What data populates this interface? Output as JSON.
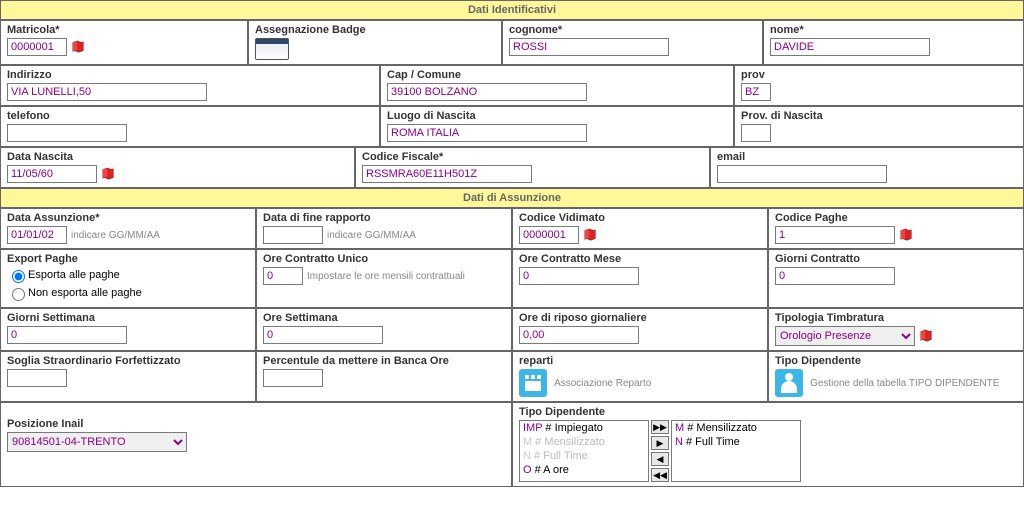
{
  "sections": {
    "identificativi": "Dati Identificativi",
    "assunzione": "Dati di Assunzione"
  },
  "ident": {
    "matricola_label": "Matricola*",
    "matricola": "0000001",
    "badge_label": "Assegnazione Badge",
    "cognome_label": "cognome*",
    "cognome": "ROSSI",
    "nome_label": "nome*",
    "nome": "DAVIDE",
    "indirizzo_label": "Indirizzo",
    "indirizzo": "VIA LUNELLI,50",
    "cap_label": "Cap / Comune",
    "cap": "39100 BOLZANO",
    "prov_label": "prov",
    "prov": "BZ",
    "telefono_label": "telefono",
    "telefono": "",
    "luogo_nascita_label": "Luogo di Nascita",
    "luogo_nascita": "ROMA ITALIA",
    "prov_nascita_label": "Prov. di Nascita",
    "prov_nascita": "",
    "data_nascita_label": "Data Nascita",
    "data_nascita": "11/05/60",
    "cf_label": "Codice Fiscale*",
    "cf": "RSSMRA60E11H501Z",
    "email_label": "email",
    "email": ""
  },
  "ass": {
    "data_ass_label": "Data Assunzione*",
    "data_ass": "01/01/02",
    "data_ass_hint": "indicare GG/MM/AA",
    "data_fine_label": "Data di fine rapporto",
    "data_fine": "",
    "data_fine_hint": "indicare GG/MM/AA",
    "cod_vid_label": "Codice Vidimato",
    "cod_vid": "0000001",
    "cod_paghe_label": "Codice Paghe",
    "cod_paghe": "1",
    "export_label": "Export Paghe",
    "export_opt1": "Esporta alle paghe",
    "export_opt2": "Non esporta alle paghe",
    "ore_unico_label": "Ore Contratto Unico",
    "ore_unico": "0",
    "ore_unico_hint": "Impostare le ore mensili contrattuali",
    "ore_mese_label": "Ore Contratto Mese",
    "ore_mese": "0",
    "giorni_contr_label": "Giorni Contratto",
    "giorni_contr": "0",
    "giorni_sett_label": "Giorni Settimana",
    "giorni_sett": "0",
    "ore_sett_label": "Ore Settimana",
    "ore_sett": "0",
    "ore_riposo_label": "Ore di riposo giornaliere",
    "ore_riposo": "0,00",
    "tipologia_timb_label": "Tipologia Timbratura",
    "tipologia_timb": "Orologio Presenze",
    "soglia_label": "Soglia Straordinario Forfettizzato",
    "soglia": "",
    "perc_banca_label": "Percentule da mettere in Banca Ore",
    "perc_banca": "",
    "reparti_label": "reparti",
    "reparti_caption": "Associazione Reparto",
    "tipo_dip_label": "Tipo Dipendente",
    "tipo_dip_caption": "Gestione della tabella TIPO DIPENDENTE"
  },
  "inail": {
    "label": "Posizione Inail",
    "value": "90814501-04-TRENTO"
  },
  "tipo_dipendente": {
    "label": "Tipo Dipendente",
    "available": [
      {
        "key": "IMP",
        "text": "Impiegato",
        "disabled": false
      },
      {
        "key": "M",
        "text": "Mensilizzato",
        "disabled": true
      },
      {
        "key": "N",
        "text": "Full Time",
        "disabled": true
      },
      {
        "key": "O",
        "text": "A ore",
        "disabled": false
      }
    ],
    "selected": [
      {
        "key": "M",
        "text": "Mensilizzato"
      },
      {
        "key": "N",
        "text": "Full Time"
      }
    ]
  }
}
